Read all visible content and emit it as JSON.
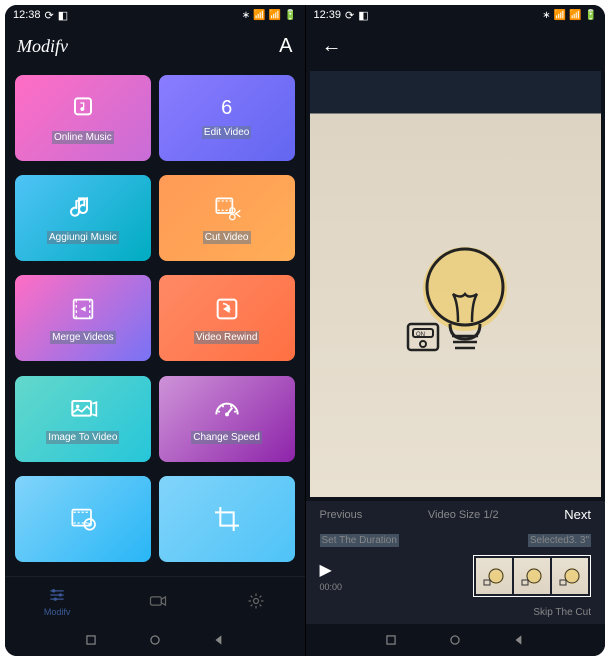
{
  "left": {
    "status": {
      "time": "12:38",
      "iconsRight": "⚫ ⌂"
    },
    "header": {
      "title": "Modifv",
      "action": "A"
    },
    "tiles": [
      {
        "label": "Online Music",
        "hasNum": false
      },
      {
        "label": "Edit Video",
        "num": "6"
      },
      {
        "label": "Aggiungi Music",
        "hasNum": false
      },
      {
        "label": "Cut Video",
        "hasNum": false
      },
      {
        "label": "Merge Videos",
        "hasNum": false
      },
      {
        "label": "Video Rewind",
        "hasNum": false
      },
      {
        "label": "Image To Video",
        "hasNum": false
      },
      {
        "label": "Change Speed",
        "hasNum": false
      },
      {
        "label": "",
        "hasNum": false
      },
      {
        "label": "",
        "hasNum": false
      }
    ],
    "nav": {
      "modify": "Modifv"
    }
  },
  "right": {
    "status": {
      "time": "12:39"
    },
    "controls": {
      "prev": "Previous",
      "size": "Video Size 1/2",
      "next": "Next",
      "duration": "Set The Duration",
      "selected": "Selected3. 3\"",
      "playTime": "00:00",
      "skip": "Skip The Cut"
    }
  }
}
